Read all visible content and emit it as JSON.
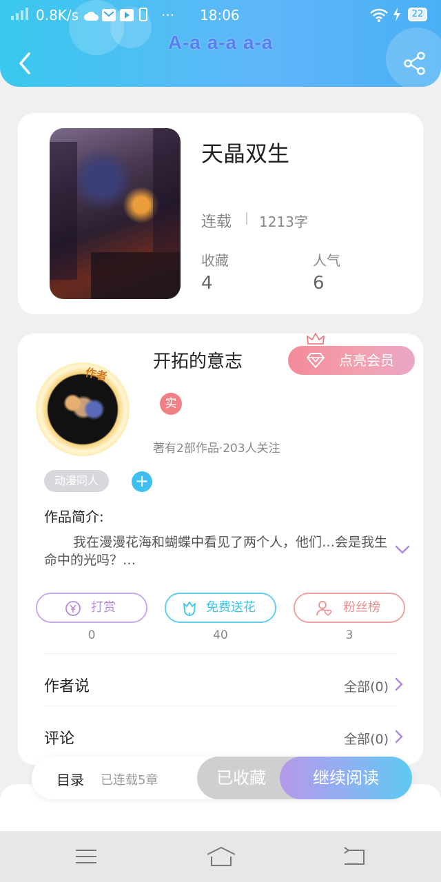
{
  "status_bar": {
    "speed": "0.8K/s",
    "dots": "···",
    "time": "18:06",
    "battery": "22"
  },
  "header": {
    "title": "A-a a-a a-a"
  },
  "book": {
    "title": "天晶双生",
    "status": "连载",
    "words": "1213字",
    "favorites_label": "收藏",
    "favorites_value": "4",
    "popularity_label": "人气",
    "popularity_value": "6"
  },
  "author": {
    "name": "开拓的意志",
    "avatar_badge": "作者",
    "vip_label": "点亮会员",
    "real_badge": "实",
    "meta": "著有2部作品·203人关注",
    "tag": "动漫同人",
    "tag_add": "+",
    "intro_label": "作品简介:",
    "intro_text": "我在漫漫花海和蝴蝶中看见了两个人，他们…会是我生命中的光吗？…"
  },
  "actions": [
    {
      "label": "打赏",
      "count": "0",
      "color": "#b58ce0"
    },
    {
      "label": "免费送花",
      "count": "40",
      "color": "#3cc4ea"
    },
    {
      "label": "粉丝榜",
      "count": "3",
      "color": "#ef8f8f"
    }
  ],
  "sections": {
    "author_says": "作者说",
    "author_says_more": "全部(0)",
    "comments": "评论",
    "comments_more": "全部(0)"
  },
  "bottom_bar": {
    "toc_label": "目录",
    "toc_count": "已连载5章",
    "collected_label": "已收藏",
    "read_label": "继续阅读"
  },
  "colors": {
    "header_start": "#39c8ee",
    "header_end": "#4ab0f5",
    "accent_purple": "#b08ae6"
  }
}
